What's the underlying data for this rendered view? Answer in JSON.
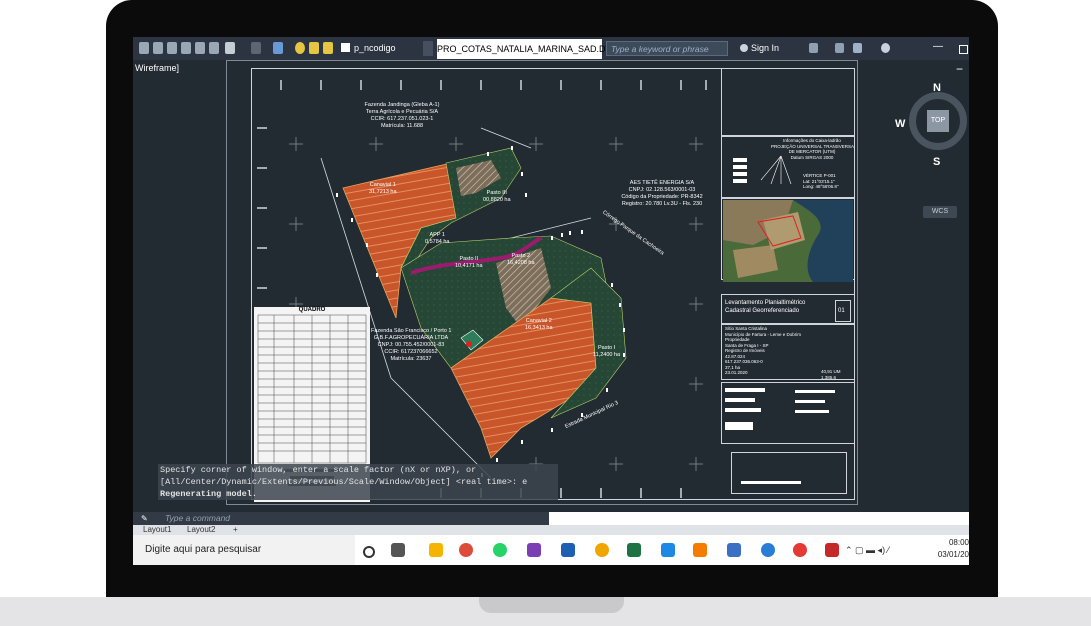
{
  "app": {
    "document_tab": "PRO_COTAS_NATALIA_MARINA_SAD.DWG",
    "search_placeholder": "Type a keyword or phrase",
    "sign_in": "Sign In",
    "layer_name": "p_ncodigo",
    "viewport_label": "Wireframe]",
    "minimize": "—",
    "view_cube": {
      "north": "N",
      "south": "S",
      "west": "W",
      "top": "TOP",
      "wcs": "WCS"
    }
  },
  "drawing": {
    "parcel_nw": "Fazenda Jandinga (Gleba A-1)\nTerra Agrícola e Pecuária S/A\nCCIR: 617.237.051.023-1\nMatrícula: 11.688",
    "parcel_east": "AES TIETÊ ENERGIA S/A\nCNPJ: 02.128.563/0001-03\nCódigo da Propriedade: PR-8342\nRegistro: 20.780 Lv.3U - Fls. 230",
    "parcel_west": "Fazenda São Francisco / Porto 1\nG.B.F.AGROPECUÁRIA LTDA\nCNPJ: 00.755.452/0001-83\nCCIR: 617237066652\nMatrícula: 23637",
    "river_label_1": "Córrego Parque da Cachoeira",
    "river_label_2": "Estrada Municipal Rio 3",
    "area_labels": [
      "Canavial 1\n31,7213 ha",
      "Pasto III\n00,8820 ha",
      "APP 1\n0,5784 ha",
      "Pasto II\n10,4171 ha",
      "Pasto 2\n16,4208 ha",
      "Canavial 2\n16,3413 ha",
      "Pasto I\n11,2400 ha"
    ],
    "legend_title": "QUADRO",
    "title_block": {
      "top_right": "Informações do Caixa-ladrão\nPROJEÇÃO UNIVERSAL TRANSVERSA\nDE MERCATOR (UTM)\nDatum SIRGAS 2000",
      "location_text": "VÉRTICE P-001\nLat: 21°03'15.1\"\nLong: 48°56'06.8\"",
      "survey_title": "Levantamento Planialtimétrico Cadastral Georreferenciado",
      "survey_num": "01",
      "info_lines": [
        "Sítio Santa Cristalina",
        "Município de Fartura - Leme e Dobrim",
        "Propriedade",
        "Santa de Fraga I - SP",
        "Registro de Imóveis",
        "42.87.024",
        "617.237.036.063-0",
        "37,1 ha",
        "23.01.2020"
      ],
      "side_vals": [
        "40,91 UM",
        "1.385,6"
      ]
    }
  },
  "command": {
    "history": [
      "Specify corner of window, enter a scale factor (nX or nXP), or",
      "[All/Center/Dynamic/Extents/Previous/Scale/Window/Object] <real time>: e",
      "Regenerating model."
    ],
    "placeholder": "Type a command"
  },
  "layout_tabs": [
    "Layout1",
    "Layout2",
    "+"
  ],
  "taskbar": {
    "search": "Digite aqui para pesquisar",
    "time": "08:00",
    "date": "03/01/20"
  }
}
